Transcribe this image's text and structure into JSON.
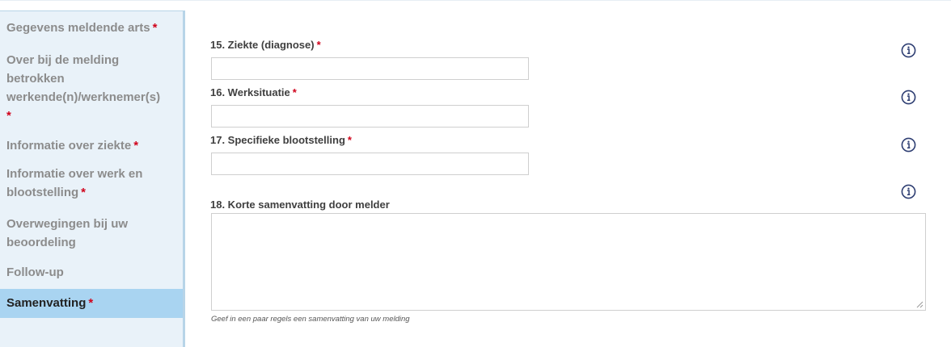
{
  "sidebar": {
    "items": [
      {
        "label": "Gegevens meldende arts",
        "required": "*"
      },
      {
        "label_lines": [
          "Over bij de melding",
          "betrokken",
          "werkende(n)/werknemer(s)"
        ],
        "required": "*"
      },
      {
        "label": "Informatie over ziekte",
        "required": "*"
      },
      {
        "label_lines": [
          "Informatie over werk en",
          "blootstelling"
        ],
        "required": "*"
      },
      {
        "label_lines": [
          "Overwegingen bij uw",
          "beoordeling"
        ]
      },
      {
        "label": "Follow-up"
      },
      {
        "label": "Samenvatting",
        "required": "*",
        "active": true
      }
    ]
  },
  "form": {
    "fields": [
      {
        "label": "15. Ziekte (diagnose)",
        "required": "*",
        "value": "",
        "info_icon": "info-circle-icon"
      },
      {
        "label": "16. Werksituatie",
        "required": "*",
        "value": "",
        "info_icon": "info-circle-icon"
      },
      {
        "label": "17. Specifieke blootstelling",
        "required": "*",
        "value": "",
        "info_icon": "info-circle-icon"
      }
    ],
    "summary": {
      "label": "18. Korte samenvatting door melder",
      "value": "",
      "hint": "Geef in een paar regels een samenvatting van uw melding",
      "info_icon": "info-circle-icon"
    }
  },
  "colors": {
    "sidebar_bg": "#e9f2f9",
    "sidebar_active_bg": "#a9d4f1",
    "required_star": "#d0021b",
    "info_icon": "#2f3f73"
  }
}
